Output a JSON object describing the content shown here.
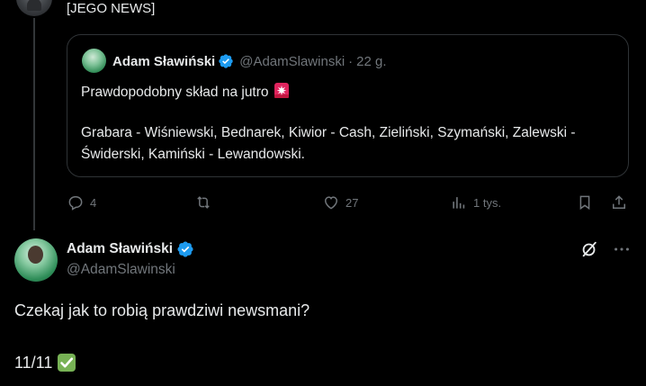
{
  "parent_post": {
    "text_tail": "[JEGO NEWS]"
  },
  "quoted_post": {
    "author_name": "Adam Sławiński",
    "handle": "@AdamSlawinski",
    "separator": "·",
    "time": "22 g.",
    "line1": "Prawdopodobny skład na jutro",
    "line2": "Grabara - Wiśniewski, Bednarek, Kiwior - Cash, Zieliński, Szymański, Zalewski - Świderski, Kamiński - Lewandowski.",
    "emoji_icon": "police-siren-icon"
  },
  "actions": {
    "replies": "4",
    "reposts": "",
    "likes": "27",
    "views": "1 tys."
  },
  "reply_post": {
    "author_name": "Adam Sławiński",
    "handle": "@AdamSlawinski",
    "text": "Czekaj jak to robią prawdziwi newsmani?",
    "score": "11/11",
    "emoji_icon": "check-mark-button-icon"
  },
  "colors": {
    "background": "#000000",
    "text": "#e7e9ea",
    "muted": "#71767b",
    "verified": "#1d9bf0",
    "border": "#2f3336"
  }
}
